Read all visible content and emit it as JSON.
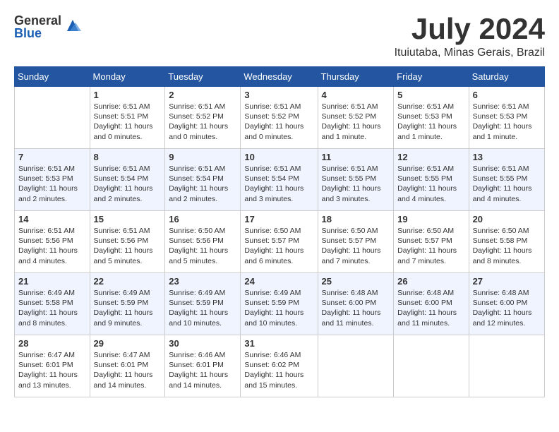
{
  "header": {
    "logo_general": "General",
    "logo_blue": "Blue",
    "month_title": "July 2024",
    "location": "Ituiutaba, Minas Gerais, Brazil"
  },
  "weekdays": [
    "Sunday",
    "Monday",
    "Tuesday",
    "Wednesday",
    "Thursday",
    "Friday",
    "Saturday"
  ],
  "weeks": [
    [
      {
        "day": "",
        "info": ""
      },
      {
        "day": "1",
        "info": "Sunrise: 6:51 AM\nSunset: 5:51 PM\nDaylight: 11 hours\nand 0 minutes."
      },
      {
        "day": "2",
        "info": "Sunrise: 6:51 AM\nSunset: 5:52 PM\nDaylight: 11 hours\nand 0 minutes."
      },
      {
        "day": "3",
        "info": "Sunrise: 6:51 AM\nSunset: 5:52 PM\nDaylight: 11 hours\nand 0 minutes."
      },
      {
        "day": "4",
        "info": "Sunrise: 6:51 AM\nSunset: 5:52 PM\nDaylight: 11 hours\nand 1 minute."
      },
      {
        "day": "5",
        "info": "Sunrise: 6:51 AM\nSunset: 5:53 PM\nDaylight: 11 hours\nand 1 minute."
      },
      {
        "day": "6",
        "info": "Sunrise: 6:51 AM\nSunset: 5:53 PM\nDaylight: 11 hours\nand 1 minute."
      }
    ],
    [
      {
        "day": "7",
        "info": "Sunrise: 6:51 AM\nSunset: 5:53 PM\nDaylight: 11 hours\nand 2 minutes."
      },
      {
        "day": "8",
        "info": "Sunrise: 6:51 AM\nSunset: 5:54 PM\nDaylight: 11 hours\nand 2 minutes."
      },
      {
        "day": "9",
        "info": "Sunrise: 6:51 AM\nSunset: 5:54 PM\nDaylight: 11 hours\nand 2 minutes."
      },
      {
        "day": "10",
        "info": "Sunrise: 6:51 AM\nSunset: 5:54 PM\nDaylight: 11 hours\nand 3 minutes."
      },
      {
        "day": "11",
        "info": "Sunrise: 6:51 AM\nSunset: 5:55 PM\nDaylight: 11 hours\nand 3 minutes."
      },
      {
        "day": "12",
        "info": "Sunrise: 6:51 AM\nSunset: 5:55 PM\nDaylight: 11 hours\nand 4 minutes."
      },
      {
        "day": "13",
        "info": "Sunrise: 6:51 AM\nSunset: 5:55 PM\nDaylight: 11 hours\nand 4 minutes."
      }
    ],
    [
      {
        "day": "14",
        "info": "Sunrise: 6:51 AM\nSunset: 5:56 PM\nDaylight: 11 hours\nand 4 minutes."
      },
      {
        "day": "15",
        "info": "Sunrise: 6:51 AM\nSunset: 5:56 PM\nDaylight: 11 hours\nand 5 minutes."
      },
      {
        "day": "16",
        "info": "Sunrise: 6:50 AM\nSunset: 5:56 PM\nDaylight: 11 hours\nand 5 minutes."
      },
      {
        "day": "17",
        "info": "Sunrise: 6:50 AM\nSunset: 5:57 PM\nDaylight: 11 hours\nand 6 minutes."
      },
      {
        "day": "18",
        "info": "Sunrise: 6:50 AM\nSunset: 5:57 PM\nDaylight: 11 hours\nand 7 minutes."
      },
      {
        "day": "19",
        "info": "Sunrise: 6:50 AM\nSunset: 5:57 PM\nDaylight: 11 hours\nand 7 minutes."
      },
      {
        "day": "20",
        "info": "Sunrise: 6:50 AM\nSunset: 5:58 PM\nDaylight: 11 hours\nand 8 minutes."
      }
    ],
    [
      {
        "day": "21",
        "info": "Sunrise: 6:49 AM\nSunset: 5:58 PM\nDaylight: 11 hours\nand 8 minutes."
      },
      {
        "day": "22",
        "info": "Sunrise: 6:49 AM\nSunset: 5:59 PM\nDaylight: 11 hours\nand 9 minutes."
      },
      {
        "day": "23",
        "info": "Sunrise: 6:49 AM\nSunset: 5:59 PM\nDaylight: 11 hours\nand 10 minutes."
      },
      {
        "day": "24",
        "info": "Sunrise: 6:49 AM\nSunset: 5:59 PM\nDaylight: 11 hours\nand 10 minutes."
      },
      {
        "day": "25",
        "info": "Sunrise: 6:48 AM\nSunset: 6:00 PM\nDaylight: 11 hours\nand 11 minutes."
      },
      {
        "day": "26",
        "info": "Sunrise: 6:48 AM\nSunset: 6:00 PM\nDaylight: 11 hours\nand 11 minutes."
      },
      {
        "day": "27",
        "info": "Sunrise: 6:48 AM\nSunset: 6:00 PM\nDaylight: 11 hours\nand 12 minutes."
      }
    ],
    [
      {
        "day": "28",
        "info": "Sunrise: 6:47 AM\nSunset: 6:01 PM\nDaylight: 11 hours\nand 13 minutes."
      },
      {
        "day": "29",
        "info": "Sunrise: 6:47 AM\nSunset: 6:01 PM\nDaylight: 11 hours\nand 14 minutes."
      },
      {
        "day": "30",
        "info": "Sunrise: 6:46 AM\nSunset: 6:01 PM\nDaylight: 11 hours\nand 14 minutes."
      },
      {
        "day": "31",
        "info": "Sunrise: 6:46 AM\nSunset: 6:02 PM\nDaylight: 11 hours\nand 15 minutes."
      },
      {
        "day": "",
        "info": ""
      },
      {
        "day": "",
        "info": ""
      },
      {
        "day": "",
        "info": ""
      }
    ]
  ]
}
